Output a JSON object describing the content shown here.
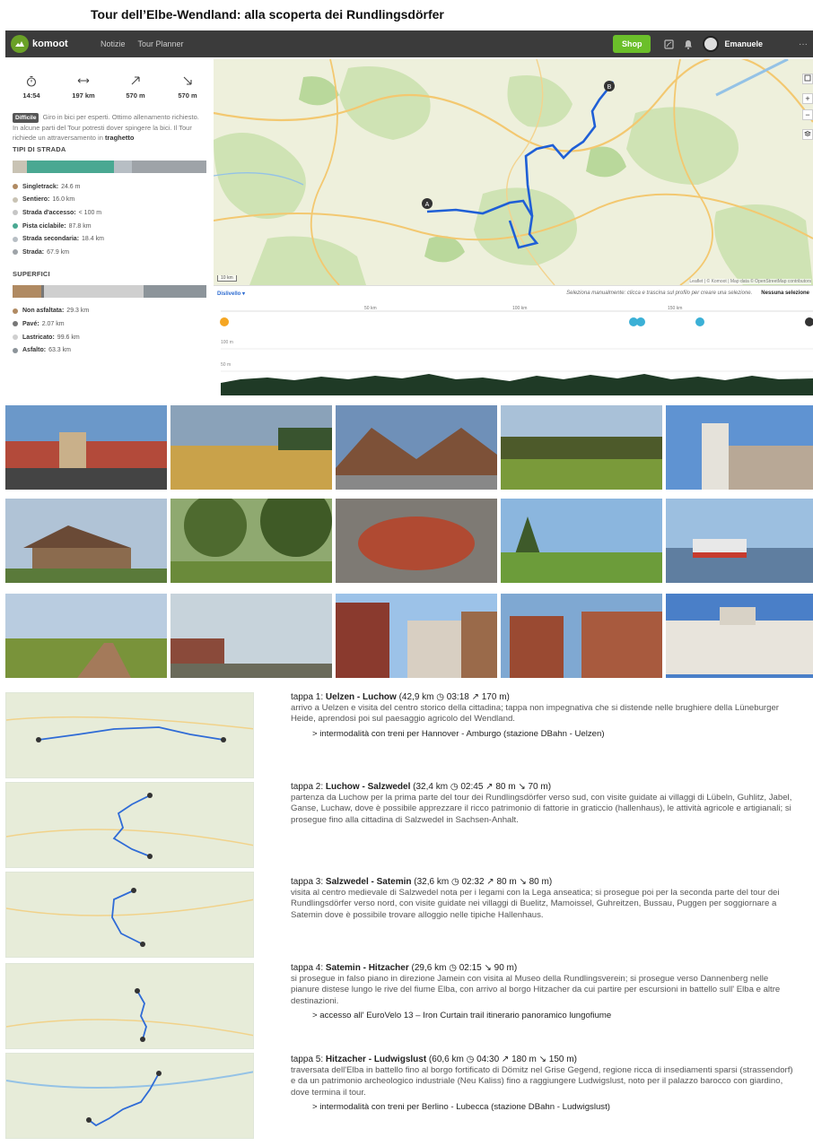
{
  "page_title": "Tour dell’Elbe-Wendland: alla scoperta dei Rundlingsdörfer",
  "header": {
    "logo_text": "komoot",
    "nav": [
      "Notizie",
      "Tour Planner"
    ],
    "shop_label": "Shop",
    "user_name": "Emanuele",
    "more": "···"
  },
  "stats": {
    "duration": "14:54",
    "distance": "197 km",
    "ascent": "570 m",
    "descent": "570 m"
  },
  "difficulty": {
    "badge": "Difficile",
    "text": "Giro in bici per esperti. Ottimo allenamento richiesto. In alcune parti del Tour potresti dover spingere la bici. Il Tour richiede un attraversamento in",
    "bold": "traghetto"
  },
  "road_types": {
    "title": "TIPI DI STRADA",
    "items": [
      {
        "label": "Singletrack:",
        "value": "24.6 m",
        "color": "#b08a62"
      },
      {
        "label": "Sentiero:",
        "value": "16.0 km",
        "color": "#c9c3b4"
      },
      {
        "label": "Strada d'accesso:",
        "value": "< 100 m",
        "color": "#c6c6c6"
      },
      {
        "label": "Pista ciclabile:",
        "value": "87.8 km",
        "color": "#4aa892"
      },
      {
        "label": "Strada secondaria:",
        "value": "18.4 km",
        "color": "#b7bec4"
      },
      {
        "label": "Strada:",
        "value": "67.9 km",
        "color": "#9ea3a8"
      }
    ]
  },
  "surfaces": {
    "title": "SUPERFICI",
    "items": [
      {
        "label": "Non asfaltata:",
        "value": "29.3 km",
        "color": "#b08a62"
      },
      {
        "label": "Pavé:",
        "value": "2.07 km",
        "color": "#777777"
      },
      {
        "label": "Lastricato:",
        "value": "99.6 km",
        "color": "#cfcfcf"
      },
      {
        "label": "Asfalto:",
        "value": "63.3 km",
        "color": "#8c949a"
      }
    ]
  },
  "map": {
    "attribution": "Leaflet | © Komoot | Map data © OpenStreetMap contributors",
    "scale": "10 km",
    "start_marker": "A",
    "end_marker": "B",
    "ctrl_plus": "+",
    "ctrl_minus": "−"
  },
  "elevation": {
    "link": "Dislivello ▾",
    "hint": "Seleziona manualmente: clicca e trascina sul profilo per creare una selezione.",
    "selection": "Nessuna selezione",
    "km_labels": [
      "50 km",
      "100 km",
      "150 km"
    ],
    "alt_labels": [
      "100 m",
      "50 m"
    ]
  },
  "stages": [
    {
      "title_prefix": "tappa 1: ",
      "title_bold": "Uelzen - Luchow",
      "title_rest": " (42,9 km ◷ 03:18  ↗ 170 m)",
      "text": "arrivo a Uelzen e visita del centro storico della cittadina; tappa non impegnativa che si distende nelle brughiere della Lüneburger Heide, aprendosi poi sul paesaggio agricolo del Wendland.",
      "note": "> intermodalità con treni per Hannover - Amburgo  (stazione DBahn - Uelzen)"
    },
    {
      "title_prefix": "tappa 2: ",
      "title_bold": "Luchow - Salzwedel",
      "title_rest": " (32,4 km ◷ 02:45  ↗ 80 m ↘ 70 m)",
      "text": "partenza da Luchow per la prima parte del tour dei Rundlingsdörfer verso sud, con visite guidate ai villaggi di Lübeln, Guhlitz, Jabel, Ganse, Luchaw, dove è possibile apprezzare il ricco patrimonio di fattorie in graticcio (hallenhaus), le attività agricole e artigianali; si prosegue fino alla cittadina di Salzwedel in Sachsen-Anhalt.",
      "note": ""
    },
    {
      "title_prefix": "tappa 3: ",
      "title_bold": "Salzwedel - Satemin",
      "title_rest": " (32,6 km ◷ 02:32  ↗ 80 m ↘ 80 m)",
      "text": "visita al centro medievale di Salzwedel nota per i legami con la Lega anseatica; si prosegue poi per la seconda parte del tour dei Rundlingsdörfer verso nord, con visite guidate nei villaggi di Buelitz, Mamoissel, Guhreitzen, Bussau, Puggen per soggiornare a Satemin dove è possibile trovare alloggio nelle tipiche Hallenhaus.",
      "note": ""
    },
    {
      "title_prefix": "tappa 4: ",
      "title_bold": "Satemin - Hitzacher",
      "title_rest": " (29,6 km ◷ 02:15  ↘ 90 m)",
      "text": "si prosegue in falso piano in direzione Jamein con visita al Museo della Rundlingsverein; si prosegue verso Dannenberg nelle pianure distese lungo le rive del fiume Elba, con arrivo al borgo Hitzacher da cui partire per escursioni in battello sull' Elba e altre destinazioni.",
      "note": "> accesso all' EuroVelo 13 – Iron Curtain trail itinerario panoramico lungofiume"
    },
    {
      "title_prefix": "tappa 5: ",
      "title_bold": "Hitzacher - Ludwigslust",
      "title_rest": " (60,6 km ◷ 04:30  ↗ 180 m ↘ 150 m)",
      "text": "traversata dell'Elba in battello fino al borgo fortificato di Dömitz nel Grise Gegend, regione ricca di insediamenti sparsi (strassendorf) e da un patrimonio archeologico industriale (Neu Kaliss) fino a raggiungere Ludwigslust, noto per il palazzo barocco con giardino, dove termina il tour.",
      "note": "> intermodalità con treni per Berlino - Lubecca  (stazione DBahn - Ludwigslust)"
    }
  ]
}
